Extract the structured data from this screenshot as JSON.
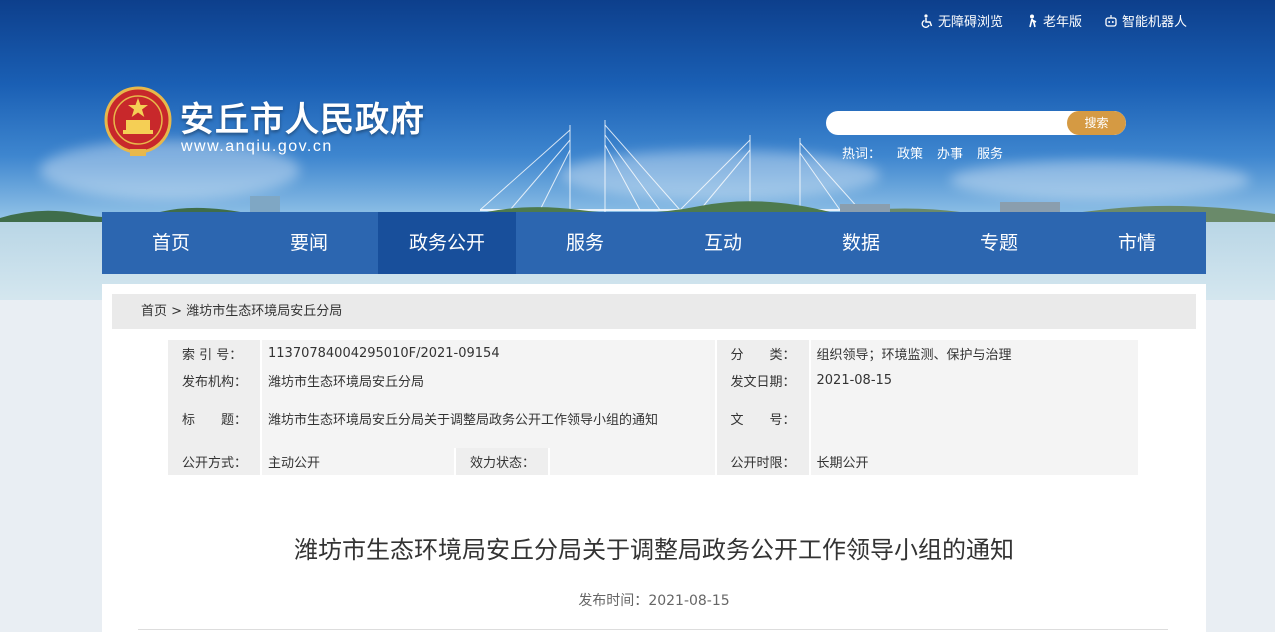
{
  "topbar": {
    "accessibility": "无障碍浏览",
    "elderly": "老年版",
    "robot": "智能机器人"
  },
  "site": {
    "title": "安丘市人民政府",
    "url": "www.anqiu.gov.cn"
  },
  "search": {
    "placeholder": "",
    "button": "搜索",
    "hot_label": "热词：",
    "hot_words": [
      "政策",
      "办事",
      "服务"
    ]
  },
  "nav": [
    "首页",
    "要闻",
    "政务公开",
    "服务",
    "互动",
    "数据",
    "专题",
    "市情"
  ],
  "breadcrumb": {
    "home": "首页",
    "sep": ">",
    "current": "潍坊市生态环境局安丘分局"
  },
  "meta": {
    "index_label": "索 引 号：",
    "index_value": "11370784004295010F/2021-09154",
    "category_label": "分　　类：",
    "category_value": "组织领导；环境监测、保护与治理",
    "publisher_label": "发布机构：",
    "publisher_value": "潍坊市生态环境局安丘分局",
    "date_label": "发文日期：",
    "date_value": "2021-08-15",
    "title_label": "标　　题：",
    "title_value": "潍坊市生态环境局安丘分局关于调整局政务公开工作领导小组的通知",
    "docno_label": "文　　号：",
    "docno_value": "",
    "open_method_label": "公开方式：",
    "open_method_value": "主动公开",
    "validity_label": "效力状态：",
    "validity_value": "",
    "open_period_label": "公开时限：",
    "open_period_value": "长期公开"
  },
  "article": {
    "title": "潍坊市生态环境局安丘分局关于调整局政务公开工作领导小组的通知",
    "pubtime_label": "发布时间：",
    "pubtime_value": "2021-08-15"
  },
  "colors": {
    "nav_bg": "#2c66b0",
    "nav_active": "#184f9b",
    "search_button": "#d59a43"
  }
}
